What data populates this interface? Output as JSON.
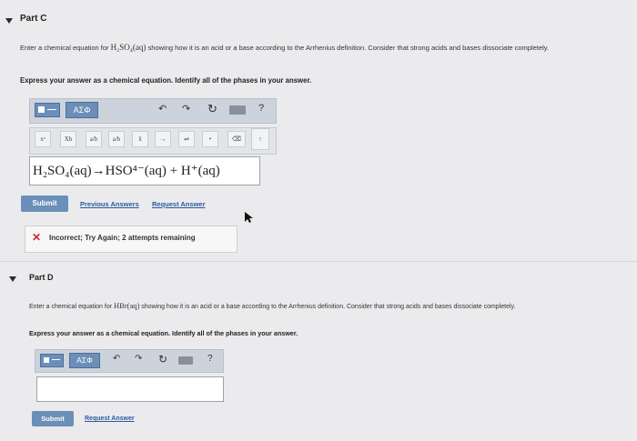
{
  "part_c": {
    "title": "Part C",
    "prompt_pre": "Enter a chemical equation for",
    "prompt_formula": "H₂SO₄(aq)",
    "prompt_post": "showing how it is an acid or a base according to the Arrhenius definition. Consider that strong acids and bases dissociate completely.",
    "instruction": "Express your answer as a chemical equation. Identify all of the phases in your answer.",
    "toolbar": {
      "greek_label": "ΑΣΦ",
      "help_label": "?"
    },
    "templates": [
      "xᵃ",
      "Xb",
      "a/b",
      "a/b",
      "x̄",
      "→",
      "⇌",
      "•",
      "⌫",
      "↑"
    ],
    "answer": "H₂SO₄(aq)→HSO⁴⁻(aq) + H⁺(aq)",
    "submit_label": "Submit",
    "previous_answers_label": "Previous Answers",
    "request_answer_label": "Request Answer",
    "feedback": {
      "icon": "✕",
      "text": "Incorrect; Try Again; 2 attempts remaining"
    }
  },
  "part_d": {
    "title": "Part D",
    "prompt_pre": "Enter a chemical equation for",
    "prompt_formula": "HBr(aq)",
    "prompt_post": "showing how it is an acid or a base according to the Arrhenius definition. Consider that strong acids and bases dissociate completely.",
    "instruction": "Express your answer as a chemical equation. Identify all of the phases in your answer.",
    "toolbar": {
      "greek_label": "ΑΣΦ",
      "help_label": "?"
    },
    "answer": "",
    "submit_label": "Submit",
    "request_answer_label": "Request Answer"
  },
  "colors": {
    "accent": "#6b8fb8",
    "error": "#cc2b2b",
    "link": "#2d5aa0"
  }
}
